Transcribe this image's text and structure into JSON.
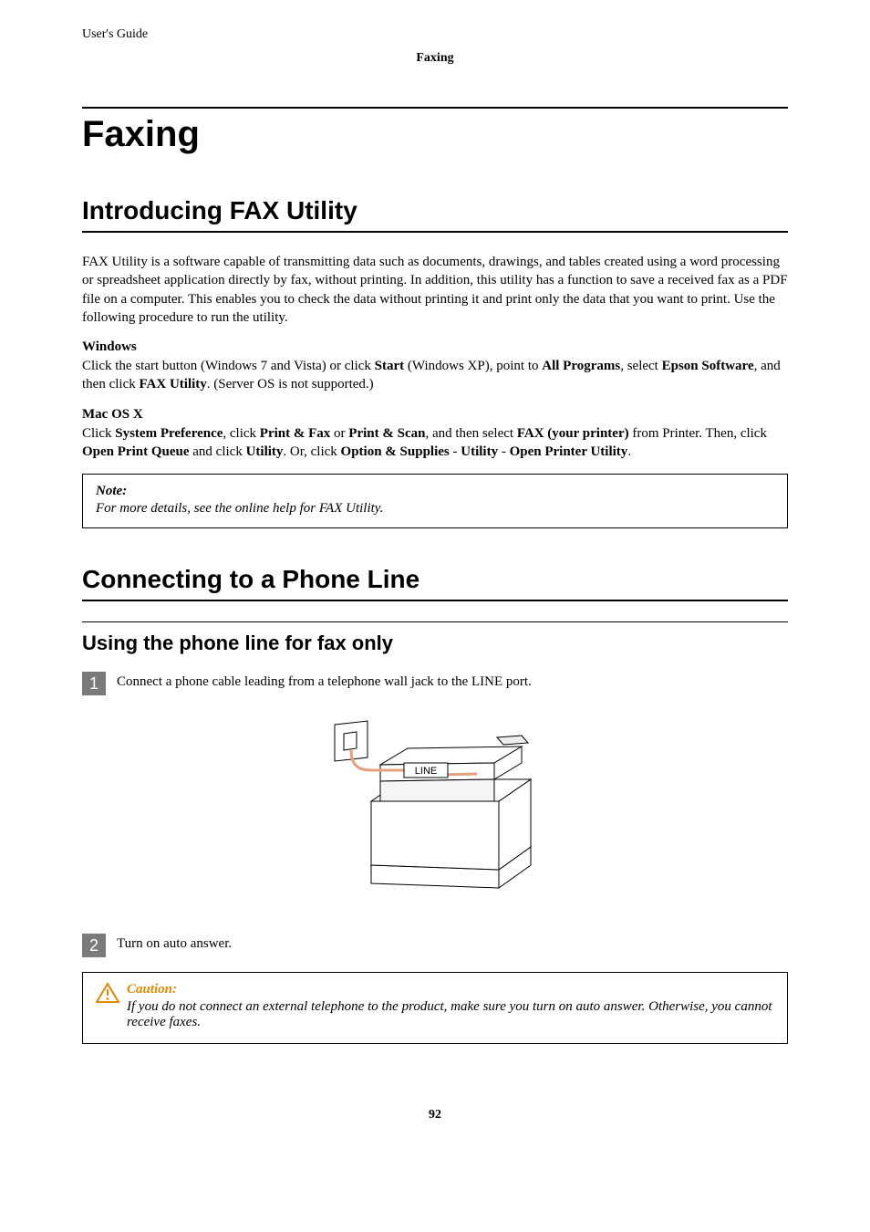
{
  "header": {
    "running_head": "User's Guide",
    "section": "Faxing"
  },
  "h1": "Faxing",
  "intro": {
    "h2": "Introducing FAX Utility",
    "para": "FAX Utility is a software capable of transmitting data such as documents, drawings, and tables created using a word processing or spreadsheet application directly by fax, without printing. In addition, this utility has a function to save a received fax as a PDF file on a computer. This enables you to check the data without printing it and print only the data that you want to print. Use the following procedure to run the utility.",
    "windows_label": "Windows",
    "win_pre": "Click the start button (Windows 7 and Vista) or click ",
    "win_b1": "Start",
    "win_mid1": " (Windows XP), point to ",
    "win_b2": "All Programs",
    "win_mid2": ", select ",
    "win_b3": "Epson Software",
    "win_mid3": ", and then click ",
    "win_b4": "FAX Utility",
    "win_post": ". (Server OS is not supported.)",
    "mac_label": "Mac OS X",
    "mac_pre": "Click ",
    "mac_b1": "System Preference",
    "mac_mid1": ", click ",
    "mac_b2": "Print & Fax",
    "mac_mid2": " or ",
    "mac_b3": "Print & Scan",
    "mac_mid3": ", and then select ",
    "mac_b4": "FAX (your printer)",
    "mac_mid4": " from Printer. Then, click ",
    "mac_b5": "Open Print Queue",
    "mac_mid5": " and click ",
    "mac_b6": "Utility",
    "mac_mid6": ". Or, click ",
    "mac_b7": "Option & Supplies",
    "mac_mid7": " - ",
    "mac_b8": "Utility",
    "mac_mid8": " - ",
    "mac_b9": "Open Printer Utility",
    "mac_post": ".",
    "note_title": "Note:",
    "note_body": "For more details, see the online help for FAX Utility."
  },
  "connect": {
    "h2": "Connecting to a Phone Line",
    "h3": "Using the phone line for fax only",
    "step1_num": "1",
    "step1_text": "Connect a phone cable leading from a telephone wall jack to the LINE port.",
    "figure_line_label": "LINE",
    "step2_num": "2",
    "step2_text": "Turn on auto answer.",
    "caution_title": "Caution:",
    "caution_body": "If you do not connect an external telephone to the product, make sure you turn on auto answer. Otherwise, you cannot receive faxes."
  },
  "page_number": "92"
}
